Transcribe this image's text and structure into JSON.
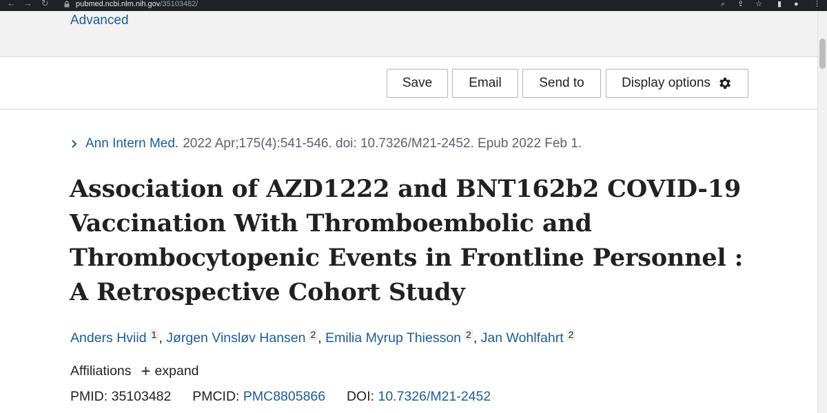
{
  "browser": {
    "url_host": "pubmed.ncbi.nlm.nih.gov",
    "url_path": "/35103482/"
  },
  "header": {
    "advanced_label": "Advanced"
  },
  "actions": {
    "save_label": "Save",
    "email_label": "Email",
    "send_to_label": "Send to",
    "display_options_label": "Display options"
  },
  "article": {
    "journal_name": "Ann Intern Med.",
    "citation": "2022 Apr;175(4):541-546. doi: 10.7326/M21-2452. Epub 2022 Feb 1.",
    "title": "Association of AZD1222 and BNT162b2 COVID-19 Vaccination With Thromboembolic and Thrombocytopenic Events in Frontline Personnel : A Retrospective Cohort Study",
    "authors": [
      {
        "name": "Anders Hviid",
        "affiliation": "1"
      },
      {
        "name": "Jørgen Vinsløv Hansen",
        "affiliation": "2"
      },
      {
        "name": "Emilia Myrup Thiesson",
        "affiliation": "2"
      },
      {
        "name": "Jan Wohlfahrt",
        "affiliation": "2"
      }
    ],
    "affiliations_label": "Affiliations",
    "expand_label": "expand",
    "pmid_label": "PMID:",
    "pmid": "35103482",
    "pmcid_label": "PMCID:",
    "pmcid": "PMC8805866",
    "doi_label": "DOI:",
    "doi": "10.7326/M21-2452"
  },
  "colors": {
    "link": "#1a5b9e",
    "text": "#212121",
    "header_band": "#f2f2f2"
  }
}
